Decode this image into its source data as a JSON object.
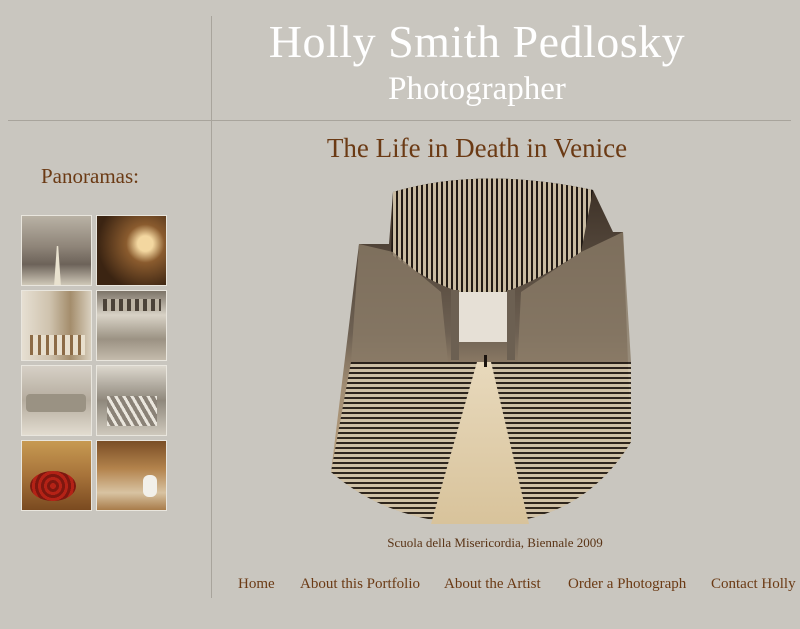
{
  "header": {
    "title": "Holly Smith Pedlosky",
    "subtitle": "Photographer"
  },
  "sidebar": {
    "heading": "Panoramas:",
    "thumbnails": [
      {
        "name": "panorama-thumbnail-1"
      },
      {
        "name": "panorama-thumbnail-2"
      },
      {
        "name": "panorama-thumbnail-3"
      },
      {
        "name": "panorama-thumbnail-4"
      },
      {
        "name": "panorama-thumbnail-5"
      },
      {
        "name": "panorama-thumbnail-6"
      },
      {
        "name": "panorama-thumbnail-7"
      },
      {
        "name": "panorama-thumbnail-8"
      }
    ]
  },
  "main": {
    "title": "The Life in Death in Venice",
    "caption": "Scuola della Misericordia, Biennale 2009"
  },
  "nav": {
    "items": [
      {
        "label": "Home"
      },
      {
        "label": "About this Portfolio"
      },
      {
        "label": "About the Artist"
      },
      {
        "label": "Order a Photograph"
      },
      {
        "label": "Contact Holly"
      }
    ]
  },
  "colors": {
    "background": "#c9c6bf",
    "accent_text": "#6b3a14",
    "header_text": "#ffffff",
    "rule": "#a8a49c"
  }
}
